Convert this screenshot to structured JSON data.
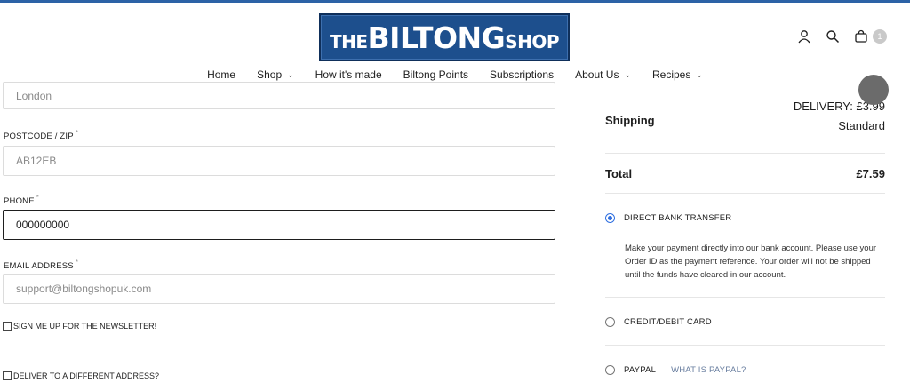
{
  "header": {
    "logo": {
      "prefix": "THE",
      "main": "BILTONG",
      "suffix": "SHOP"
    },
    "cart_count": "1",
    "icons": [
      "user-icon",
      "search-icon",
      "cart-icon"
    ]
  },
  "nav": [
    {
      "label": "Home",
      "has_menu": false
    },
    {
      "label": "Shop",
      "has_menu": true
    },
    {
      "label": "How it's made",
      "has_menu": false
    },
    {
      "label": "Biltong Points",
      "has_menu": false
    },
    {
      "label": "Subscriptions",
      "has_menu": false
    },
    {
      "label": "About Us",
      "has_menu": true
    },
    {
      "label": "Recipes",
      "has_menu": true
    }
  ],
  "form": {
    "city_value": "London",
    "postcode_label": "POSTCODE / ZIP",
    "postcode_value": "AB12EB",
    "phone_label": "PHONE",
    "phone_value": "000000000",
    "email_label": "EMAIL ADDRESS",
    "email_value": "support@biltongshopuk.com",
    "required_mark": "*",
    "newsletter_label": "SIGN ME UP FOR THE NEWSLETTER!",
    "different_address_label": "DELIVER TO A DIFFERENT ADDRESS?"
  },
  "summary": {
    "shipping_label": "Shipping",
    "shipping_value": "DELIVERY: £3.99",
    "shipping_method": "Standard",
    "total_label": "Total",
    "total_value": "£7.59"
  },
  "payment": {
    "options": [
      {
        "label": "DIRECT BANK TRANSFER",
        "selected": true
      },
      {
        "label": "CREDIT/DEBIT CARD",
        "selected": false
      },
      {
        "label": "PAYPAL",
        "selected": false
      }
    ],
    "bank_description": "Make your payment directly into our bank account. Please use your Order ID as the payment reference. Your order will not be shipped until the funds have cleared in our account.",
    "paypal_link": "WHAT IS PAYPAL?"
  },
  "colors": {
    "brand": "#1d4f8d",
    "accent": "#2f6fe0"
  }
}
